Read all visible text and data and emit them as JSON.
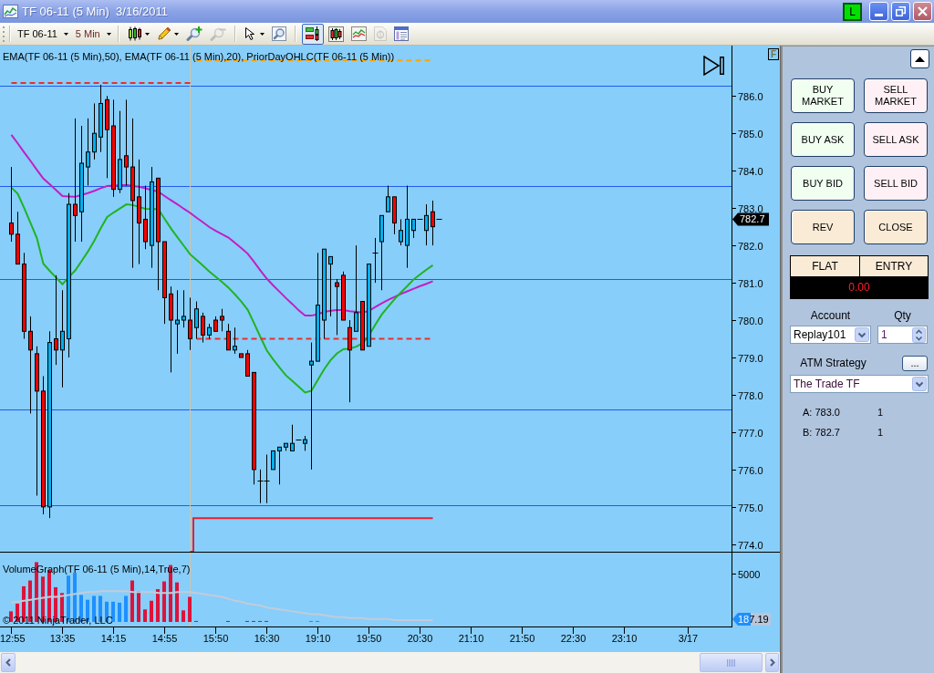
{
  "title_bar": {
    "title": "TF 06-11 (5 Min)  3/16/2011",
    "badge": "L"
  },
  "toolbar": {
    "instrument": "TF 06-11",
    "interval": "5 Min",
    "tool_groups": [
      [
        {
          "kind": "chart-style",
          "dropdown": true,
          "disabled": false,
          "pressed": false
        },
        {
          "kind": "draw",
          "dropdown": true,
          "disabled": false,
          "pressed": false
        },
        {
          "kind": "zoom-in",
          "dropdown": false,
          "disabled": false,
          "pressed": false
        },
        {
          "kind": "zoom-out",
          "dropdown": false,
          "disabled": true,
          "pressed": false
        }
      ],
      [
        {
          "kind": "cursor",
          "dropdown": true,
          "disabled": false,
          "pressed": false
        },
        {
          "kind": "data-box",
          "dropdown": false,
          "disabled": false,
          "pressed": false
        }
      ],
      [
        {
          "kind": "chart-trader",
          "dropdown": false,
          "disabled": false,
          "pressed": true
        },
        {
          "kind": "bars",
          "dropdown": false,
          "disabled": false,
          "pressed": false
        },
        {
          "kind": "indicators",
          "dropdown": false,
          "disabled": false,
          "pressed": false
        },
        {
          "kind": "strategies",
          "dropdown": false,
          "disabled": true,
          "pressed": false
        },
        {
          "kind": "properties",
          "dropdown": false,
          "disabled": false,
          "pressed": false
        }
      ]
    ]
  },
  "chart": {
    "corner_button": "F",
    "copyright": "© 2011 NinjaTrader, LLC",
    "chart_data": [
      {
        "type": "candlestick",
        "title": "EMA(TF 06-11 (5 Min),50), EMA(TF 06-11 (5 Min),20), PriorDayOHLC(TF 06-11 (5 Min))",
        "tick_labels": "y",
        "ylim": [
          773.8,
          787.3
        ],
        "yticks": [
          {
            "value": 774,
            "label": "774.0"
          },
          {
            "value": 775,
            "label": "775.0"
          },
          {
            "value": 776,
            "label": "776.0"
          },
          {
            "value": 777,
            "label": "777.0"
          },
          {
            "value": 778,
            "label": "778.0"
          },
          {
            "value": 779,
            "label": "779.0"
          },
          {
            "value": 780,
            "label": "780.0"
          },
          {
            "value": 781,
            "label": "781.0"
          },
          {
            "value": 782,
            "label": "782.0"
          },
          {
            "value": 783,
            "label": "783.0"
          },
          {
            "value": 784,
            "label": "784.0"
          },
          {
            "value": 785,
            "label": "785.0"
          },
          {
            "value": 786,
            "label": "786.0"
          }
        ],
        "ohlc": [
          [
            782.6,
            784.1,
            782.1,
            782.3
          ],
          [
            782.3,
            782.9,
            781.5,
            781.5
          ],
          [
            781.5,
            781.8,
            779.5,
            779.7
          ],
          [
            779.7,
            780.1,
            777.5,
            779.2
          ],
          [
            779.1,
            779.3,
            775.3,
            778.1
          ],
          [
            778.1,
            778.5,
            774.8,
            775.0
          ],
          [
            775.0,
            779.7,
            774.7,
            779.4
          ],
          [
            779.5,
            781.2,
            778.8,
            779.2
          ],
          [
            779.2,
            780.8,
            778.2,
            779.7
          ],
          [
            779.5,
            783.4,
            779.0,
            783.1
          ],
          [
            783.1,
            785.4,
            782.1,
            782.8
          ],
          [
            782.9,
            785.2,
            782.1,
            784.2
          ],
          [
            784.1,
            785.4,
            783.6,
            784.5
          ],
          [
            784.5,
            785.8,
            784.3,
            785.0
          ],
          [
            784.9,
            786.3,
            784.5,
            785.8
          ],
          [
            785.9,
            786.0,
            783.8,
            785.1
          ],
          [
            785.2,
            785.9,
            783.3,
            783.5
          ],
          [
            783.5,
            785.6,
            783.4,
            784.3
          ],
          [
            784.4,
            785.9,
            783.6,
            784.1
          ],
          [
            784.1,
            785.4,
            781.4,
            783.2
          ],
          [
            783.3,
            784.3,
            781.5,
            782.6
          ],
          [
            782.7,
            783.6,
            781.9,
            782.1
          ],
          [
            782.0,
            784.1,
            781.4,
            783.7
          ],
          [
            783.8,
            783.8,
            780.8,
            782.1
          ],
          [
            782.1,
            782.1,
            779.9,
            780.6
          ],
          [
            780.7,
            780.9,
            778.6,
            780.0
          ],
          [
            779.9,
            780.8,
            779.1,
            780.0
          ],
          [
            780.0,
            780.8,
            779.8,
            780.1
          ],
          [
            780.0,
            780.6,
            779.2,
            779.5
          ],
          [
            779.8,
            780.5,
            779.5,
            780.3
          ],
          [
            780.1,
            780.2,
            779.4,
            779.6
          ],
          [
            779.6,
            779.9,
            779.5,
            779.8
          ],
          [
            780.0,
            780.1,
            779.7,
            779.7
          ],
          [
            780.1,
            780.3,
            779.7,
            780.0
          ],
          [
            779.7,
            779.9,
            779.2,
            779.2
          ],
          [
            779.2,
            779.8,
            779.1,
            779.3
          ],
          [
            779.1,
            779.1,
            779.0,
            779.0
          ],
          [
            779.1,
            779.2,
            778.5,
            778.5
          ],
          [
            778.6,
            778.6,
            775.6,
            776.0
          ],
          [
            775.7,
            776.0,
            775.1,
            775.7
          ],
          [
            775.7,
            776.4,
            775.1,
            775.7
          ],
          [
            776.0,
            776.5,
            776.0,
            776.5
          ],
          [
            776.5,
            776.6,
            775.6,
            776.6
          ],
          [
            776.6,
            776.7,
            776.5,
            776.7
          ],
          [
            776.5,
            777.2,
            776.5,
            776.7
          ],
          [
            776.8,
            776.8,
            776.8,
            776.8
          ],
          [
            776.7,
            776.9,
            776.5,
            776.8
          ],
          [
            778.8,
            779.4,
            776.0,
            778.9
          ],
          [
            778.9,
            781.8,
            778.9,
            780.4
          ],
          [
            780.0,
            781.9,
            779.5,
            781.9
          ],
          [
            781.5,
            781.7,
            780.1,
            781.7
          ],
          [
            781.0,
            781.1,
            779.6,
            780.9
          ],
          [
            781.2,
            781.3,
            780.0,
            780.0
          ],
          [
            779.8,
            780.0,
            777.8,
            779.2
          ],
          [
            779.7,
            782.0,
            779.7,
            780.2
          ],
          [
            780.5,
            780.5,
            779.2,
            779.2
          ],
          [
            779.3,
            781.5,
            779.3,
            781.5
          ],
          [
            781.8,
            782.2,
            781.0,
            781.8
          ],
          [
            782.1,
            782.8,
            780.8,
            782.8
          ],
          [
            782.9,
            783.6,
            782.9,
            783.3
          ],
          [
            783.3,
            783.3,
            782.3,
            782.6
          ],
          [
            782.1,
            782.7,
            782.0,
            782.4
          ],
          [
            782.0,
            783.6,
            781.4,
            782.7
          ],
          [
            782.4,
            782.7,
            782.2,
            782.7
          ],
          [
            782.7,
            782.7,
            782.7,
            782.7
          ],
          [
            782.4,
            783.1,
            782.0,
            782.8
          ],
          [
            782.9,
            783.2,
            782.0,
            782.5
          ],
          [
            782.7,
            782.7,
            782.7,
            782.7
          ]
        ],
        "series": [
          {
            "type": "line",
            "color": "#c41ec4",
            "values": [
              784.96,
              784.73,
              784.49,
              784.26,
              784.02,
              783.79,
              783.64,
              783.48,
              783.32,
              783.31,
              783.3,
              783.35,
              783.4,
              783.46,
              783.53,
              783.59,
              783.6,
              783.61,
              783.62,
              783.59,
              783.57,
              783.53,
              783.48,
              783.44,
              783.32,
              783.21,
              783.1,
              782.98,
              782.87,
              782.74,
              782.62,
              782.49,
              782.39,
              782.3,
              782.21,
              782.07,
              781.93,
              781.78,
              781.56,
              781.33,
              781.11,
              780.93,
              780.76,
              780.59,
              780.43,
              780.26,
              780.12,
              780.12,
              780.16,
              780.22,
              780.25,
              780.27,
              780.27,
              780.24,
              780.22,
              780.2,
              780.25,
              780.35,
              780.45,
              780.54,
              780.62,
              780.7,
              780.77,
              780.84,
              780.91,
              780.97,
              781.04,
              null
            ]
          },
          {
            "type": "line",
            "color": "#1fb41f",
            "values": [
              783.55,
              783.38,
              783.0,
              782.6,
              782.19,
              781.51,
              781.32,
              781.14,
              780.96,
              781.15,
              781.33,
              781.58,
              781.84,
              782.13,
              782.46,
              782.76,
              782.88,
              782.99,
              783.1,
              783.08,
              783.03,
              782.98,
              782.97,
              782.97,
              782.71,
              782.45,
              782.22,
              781.99,
              781.76,
              781.61,
              781.46,
              781.3,
              781.16,
              781.02,
              780.87,
              780.69,
              780.5,
              780.28,
              779.92,
              779.55,
              779.19,
              778.95,
              778.73,
              778.52,
              778.37,
              778.22,
              778.06,
              778.11,
              778.4,
              778.69,
              778.93,
              779.11,
              779.22,
              779.24,
              779.29,
              779.38,
              779.59,
              779.88,
              780.15,
              780.36,
              780.56,
              780.74,
              780.91,
              781.09,
              781.22,
              781.35,
              781.47,
              null
            ]
          },
          {
            "type": "line",
            "color": "#e8302c",
            "line_style": "dashed",
            "values": [
              786.35,
              786.35,
              786.35,
              786.35,
              786.35,
              786.35,
              786.35,
              786.35,
              786.35,
              786.35,
              786.35,
              786.35,
              786.35,
              786.35,
              786.35,
              786.35,
              786.35,
              786.35,
              786.35,
              786.35,
              786.35,
              786.35,
              786.35,
              786.35,
              786.35,
              786.35,
              786.35,
              786.35,
              786.35,
              null,
              null,
              null,
              null,
              null,
              null,
              null,
              null,
              null,
              null,
              null,
              null,
              null,
              null,
              null,
              null,
              null,
              null,
              null,
              null,
              null,
              null,
              null,
              null,
              null,
              null,
              null,
              null,
              null,
              null,
              null,
              null,
              null,
              null,
              null,
              null,
              null,
              null,
              null
            ]
          },
          {
            "type": "line",
            "color": "#e8302c",
            "line_style": "dashed",
            "values": [
              null,
              null,
              null,
              null,
              null,
              null,
              null,
              null,
              null,
              null,
              null,
              null,
              null,
              null,
              null,
              null,
              null,
              null,
              null,
              null,
              null,
              null,
              null,
              null,
              null,
              null,
              null,
              null,
              null,
              779.5,
              779.5,
              779.5,
              779.5,
              779.5,
              779.5,
              779.5,
              779.5,
              779.5,
              779.5,
              779.5,
              779.5,
              779.5,
              779.5,
              779.5,
              779.5,
              779.5,
              779.5,
              779.5,
              779.5,
              779.5,
              779.5,
              779.5,
              779.5,
              779.5,
              779.5,
              779.5,
              779.5,
              779.5,
              779.5,
              779.5,
              779.5,
              779.5,
              779.5,
              779.5,
              779.5,
              779.5,
              779.5,
              null
            ]
          },
          {
            "type": "line",
            "color": "#ffa500",
            "line_style": "dashed",
            "values": [
              null,
              null,
              null,
              null,
              null,
              null,
              null,
              null,
              null,
              null,
              null,
              null,
              null,
              null,
              null,
              null,
              null,
              null,
              null,
              null,
              null,
              null,
              null,
              null,
              null,
              null,
              null,
              null,
              null,
              786.95,
              786.95,
              786.95,
              786.95,
              786.95,
              786.95,
              786.95,
              786.95,
              786.95,
              786.95,
              786.95,
              786.95,
              786.95,
              786.95,
              786.95,
              786.95,
              786.95,
              786.95,
              786.95,
              786.95,
              786.95,
              786.95,
              786.95,
              786.95,
              786.95,
              786.95,
              786.95,
              786.95,
              786.95,
              786.95,
              786.95,
              786.95,
              786.95,
              786.95,
              786.95,
              786.95,
              786.95,
              786.95,
              null
            ]
          },
          {
            "type": "step",
            "color": "#e8202c",
            "values": [
              null,
              null,
              null,
              null,
              null,
              null,
              null,
              null,
              null,
              null,
              null,
              null,
              null,
              null,
              null,
              null,
              null,
              null,
              null,
              null,
              null,
              null,
              null,
              null,
              null,
              null,
              null,
              null,
              773.8,
              774.7,
              774.7,
              774.7,
              774.7,
              774.7,
              774.7,
              774.7,
              774.7,
              774.7,
              774.7,
              774.7,
              774.7,
              774.7,
              774.7,
              774.7,
              774.7,
              774.7,
              774.7,
              774.7,
              774.7,
              774.7,
              774.7,
              774.7,
              774.7,
              774.7,
              774.7,
              774.7,
              774.7,
              774.7,
              774.7,
              774.7,
              774.7,
              774.7,
              774.7,
              774.7,
              774.7,
              774.7,
              774.7,
              null
            ]
          }
        ],
        "ref_lines": [
          {
            "axis": "y",
            "value": 786.27,
            "color": "#1f5cf0",
            "line_style": "solid"
          },
          {
            "axis": "y",
            "value": 783.6,
            "color": "#1f5cf0",
            "line_style": "solid"
          },
          {
            "axis": "y",
            "value": 781.1,
            "color": "#1f5cf0",
            "line_style": "solid"
          },
          {
            "axis": "y",
            "value": 777.6,
            "color": "#1f5cf0",
            "line_style": "solid"
          },
          {
            "axis": "y",
            "value": 775.05,
            "color": "#1f5cf0",
            "line_style": "solid"
          }
        ],
        "annotations": [
          "782.7"
        ]
      },
      {
        "type": "bar",
        "title": "VolumeGraph(TF 06-11 (5 Min),14,True,7)",
        "ylim": [
          0,
          7000
        ],
        "yticks": [
          {
            "value": 5000,
            "label": "5000"
          }
        ],
        "categories": [
          "12:55",
          null,
          null,
          null,
          null,
          null,
          null,
          null,
          "13:35",
          null,
          null,
          null,
          null,
          null,
          null,
          null,
          "14:15",
          null,
          null,
          null,
          null,
          null,
          null,
          null,
          "14:55",
          null,
          null,
          null,
          null,
          null,
          null,
          null,
          "15:50",
          null,
          null,
          null,
          null,
          null,
          null,
          null,
          "16:30",
          null,
          null,
          null,
          null,
          null,
          null,
          null,
          "19:10",
          null,
          null,
          null,
          null,
          null,
          null,
          null,
          "19:50",
          null,
          null,
          null,
          null,
          null,
          null,
          null,
          "20:30",
          null,
          null,
          null,
          null,
          null,
          null,
          null,
          "21:10",
          null,
          null,
          null,
          null,
          null,
          null,
          null,
          "21:50",
          null,
          null,
          null,
          null,
          null,
          null,
          null,
          "22:30",
          null,
          null,
          null,
          null,
          null,
          null,
          null,
          "23:10",
          null,
          null,
          null,
          null,
          null,
          null,
          null,
          null,
          null,
          "3/17",
          null,
          null,
          null,
          null,
          null,
          null
        ],
        "values": [
          1100,
          1900,
          3700,
          4300,
          6200,
          4700,
          5400,
          3600,
          3000,
          4800,
          5100,
          2800,
          2300,
          2700,
          2700,
          2100,
          2100,
          2000,
          2700,
          4300,
          3200,
          1300,
          2200,
          3400,
          4200,
          5900,
          4100,
          1200,
          2600,
          100,
          null,
          null,
          null,
          null,
          100,
          null,
          null,
          100,
          100,
          100,
          100,
          null,
          null,
          null,
          null,
          null,
          null,
          100,
          100,
          null,
          null,
          null,
          null,
          null,
          null,
          null,
          null,
          null,
          null,
          null,
          null,
          null,
          null,
          null,
          null,
          null,
          null,
          null,
          null,
          null,
          null,
          null,
          null,
          null,
          null,
          null,
          null,
          null,
          null,
          null,
          null,
          null,
          null,
          null,
          null,
          null,
          null,
          null,
          null,
          null,
          null,
          null,
          null,
          null,
          null,
          null,
          null,
          null,
          null,
          null,
          null,
          null,
          null,
          null,
          null,
          null,
          null,
          null,
          null,
          null,
          null,
          null,
          null
        ],
        "colors": [
          "#dc143c",
          "#dc143c",
          "#dc143c",
          "#dc143c",
          "#dc143c",
          "#dc143c",
          "#dc143c",
          "#dc143c",
          "#dc143c",
          "#1e90ff",
          "#1e90ff",
          "#1e90ff",
          "#1e90ff",
          "#1e90ff",
          "#1e90ff",
          "#1e90ff",
          "#1e90ff",
          "#1e90ff",
          "#1e90ff",
          "#dc143c",
          "#dc143c",
          "#dc143c",
          "#dc143c",
          "#dc143c",
          "#dc143c",
          "#dc143c",
          "#dc143c",
          "#dc143c",
          "#dc143c",
          "#dc143c",
          null,
          null,
          null,
          null,
          "#dc143c",
          null,
          null,
          "#dc143c",
          "#dc143c",
          "#dc143c",
          "#dc143c",
          null,
          null,
          null,
          null,
          null,
          null,
          "#1e90ff",
          "#1e90ff",
          null,
          null,
          null,
          null,
          null,
          null,
          null,
          null,
          null,
          null,
          null,
          null,
          null,
          null,
          null,
          null,
          null,
          null,
          null,
          null,
          null,
          null,
          null,
          null,
          null,
          null,
          null,
          null,
          null,
          null,
          null,
          null,
          null,
          null,
          null,
          null,
          null,
          null,
          null,
          null,
          null,
          null,
          null,
          null,
          null,
          null,
          null,
          null,
          null,
          null,
          null,
          null,
          null,
          null,
          null,
          null,
          null,
          null,
          null,
          null,
          null,
          null,
          null,
          null
        ],
        "series": [
          {
            "type": "line",
            "color": "#c3cbd9",
            "values": [
              2000,
              2100,
              2200,
              2300,
              2400,
              2500,
              2600,
              2600,
              2700,
              2800,
              2900,
              3000,
              3100,
              3100,
              3200,
              3200,
              3200,
              3200,
              3200,
              3100,
              3100,
              3100,
              3100,
              3000,
              3000,
              3000,
              3100,
              3100,
              3100,
              3000,
              2900,
              2800,
              2700,
              2600,
              2400,
              2200,
              2100,
              1900,
              1800,
              1700,
              1500,
              1400,
              1300,
              1200,
              1100,
              1000,
              900,
              800,
              800,
              700,
              600,
              500,
              500,
              400,
              400,
              400,
              300,
              300,
              300,
              300,
              200,
              200,
              200,
              200,
              200,
              200,
              187.19,
              null,
              null,
              null,
              null,
              null,
              null,
              null,
              null,
              null,
              null,
              null,
              null,
              null,
              null,
              null,
              null,
              null,
              null,
              null,
              null,
              null,
              null,
              null,
              null,
              null,
              null,
              null,
              null,
              null,
              null,
              null,
              null,
              null,
              null,
              null,
              null,
              null,
              null,
              null,
              null,
              null,
              null,
              null,
              null,
              null,
              null
            ]
          }
        ],
        "annotations": [
          "187.19"
        ]
      }
    ]
  },
  "chart_trader": {
    "order_buttons": [
      {
        "label": "BUY MARKET",
        "kind": "buy"
      },
      {
        "label": "SELL MARKET",
        "kind": "sell"
      },
      {
        "label": "BUY ASK",
        "kind": "buy"
      },
      {
        "label": "SELL ASK",
        "kind": "sell"
      },
      {
        "label": "BUY BID",
        "kind": "buy"
      },
      {
        "label": "SELL BID",
        "kind": "sell"
      },
      {
        "label": "REV",
        "kind": "exit"
      },
      {
        "label": "CLOSE",
        "kind": "exit"
      }
    ],
    "position": {
      "status": "FLAT",
      "entry_label": "ENTRY",
      "pnl": "0.00"
    },
    "account": {
      "label": "Account",
      "value": "Replay101"
    },
    "quantity": {
      "label": "Qty",
      "value": "1"
    },
    "atm_strategy": {
      "label": "ATM Strategy",
      "button": "...",
      "value": "The Trade TF"
    },
    "quotes": [
      {
        "label": "A: 783.0",
        "size": "1"
      },
      {
        "label": "B: 782.7",
        "size": "1"
      }
    ]
  }
}
